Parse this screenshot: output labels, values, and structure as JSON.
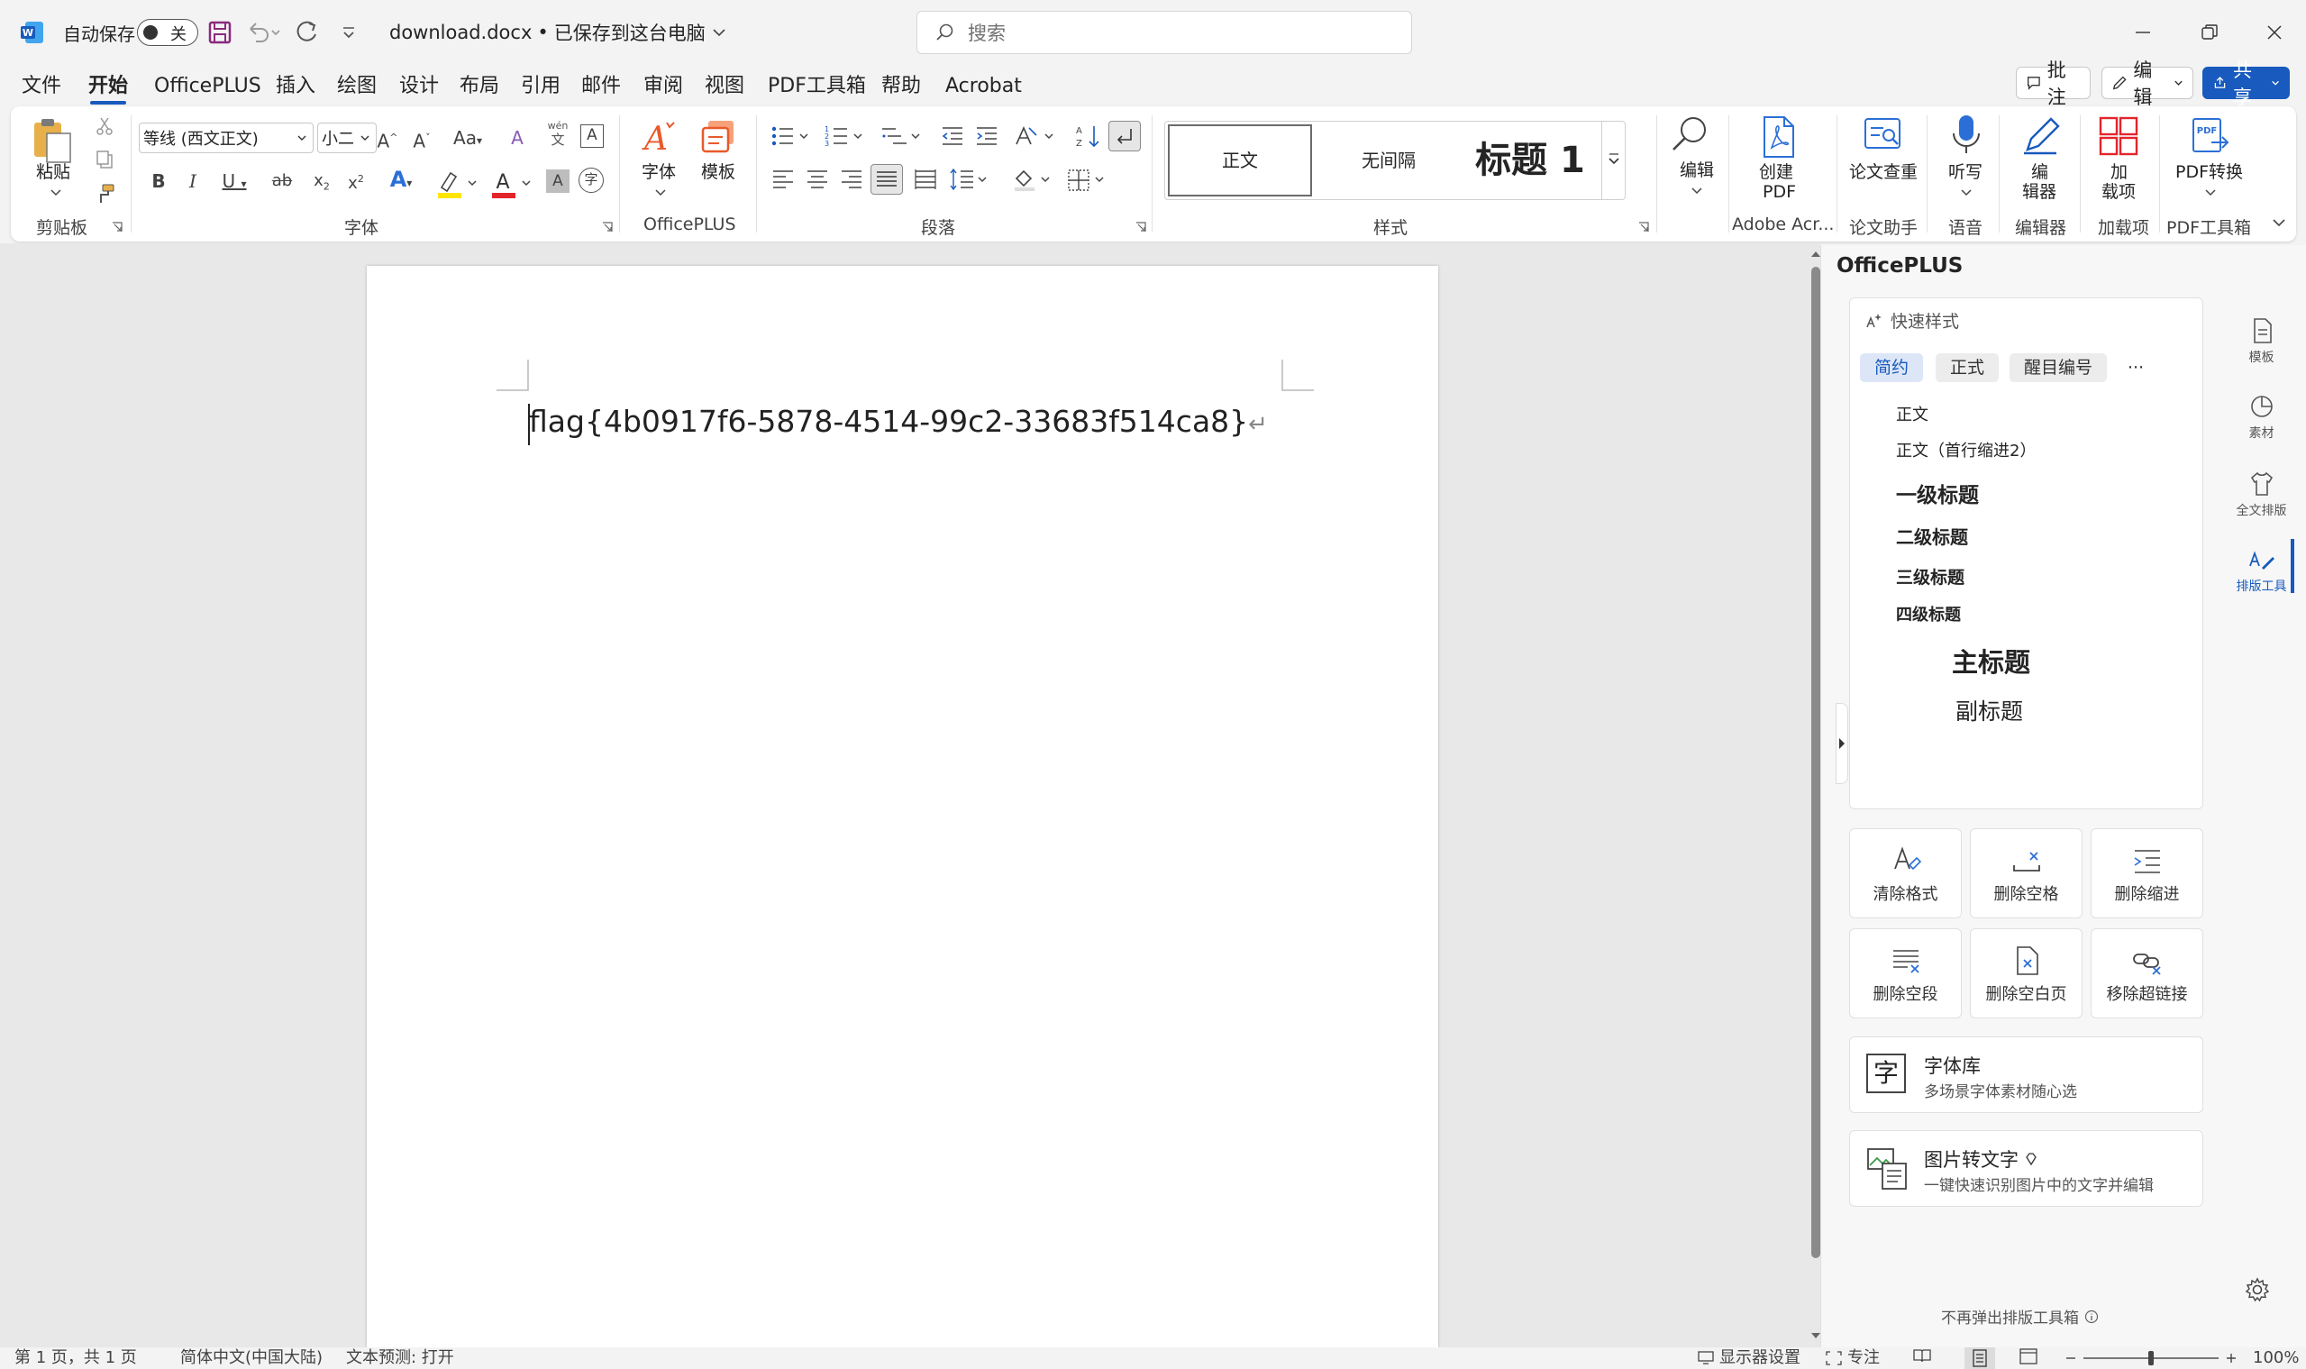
{
  "titlebar": {
    "autosave_label": "自动保存",
    "autosave_state": "关",
    "filename": "download.docx",
    "separator": "•",
    "save_status": "已保存到这台电脑",
    "search_placeholder": "搜索"
  },
  "menu": {
    "tabs": [
      "文件",
      "开始",
      "OfficePLUS",
      "插入",
      "绘图",
      "设计",
      "布局",
      "引用",
      "邮件",
      "审阅",
      "视图",
      "PDF工具箱",
      "帮助",
      "Acrobat"
    ],
    "active": "开始",
    "comment_button": "批注",
    "edit_button": "编辑",
    "share_button": "共享"
  },
  "ribbon": {
    "clipboard": {
      "paste": "粘贴",
      "group": "剪贴板"
    },
    "font": {
      "name": "等线 (西文正文)",
      "size": "小二",
      "group": "字体",
      "case": "Aa",
      "phonetic_top": "wén",
      "phonetic_bottom": "文"
    },
    "officeplus": {
      "font": "字体",
      "template": "模板",
      "group": "OfficePLUS"
    },
    "paragraph": {
      "group": "段落"
    },
    "styles": {
      "items": [
        "正文",
        "无间隔",
        "标题 1"
      ],
      "group": "样式"
    },
    "editing": {
      "label": "编辑"
    },
    "adobe": {
      "label_line1": "创建",
      "label_line2": "PDF",
      "group": "Adobe Acr..."
    },
    "paper": {
      "label": "论文查重",
      "group": "论文助手"
    },
    "voice": {
      "label": "听写",
      "group": "语音"
    },
    "editor": {
      "label_line1": "编",
      "label_line2": "辑器",
      "group": "编辑器"
    },
    "addins": {
      "label_line1": "加",
      "label_line2": "载项",
      "group": "加载项"
    },
    "pdftools": {
      "label": "PDF转换",
      "group": "PDF工具箱"
    }
  },
  "document": {
    "text": "flag{4b0917f6-5878-4514-99c2-33683f514ca8}",
    "para_mark": "↵"
  },
  "panel": {
    "title": "OfficePLUS",
    "quick_style_title": "快速样式",
    "style_tabs": [
      "简约",
      "正式",
      "醒目编号",
      "···"
    ],
    "active_style_tab": "简约",
    "styles": [
      "正文",
      "正文（首行缩进2）",
      "一级标题",
      "二级标题",
      "三级标题",
      "四级标题",
      "主标题",
      "副标题"
    ],
    "tools": [
      "清除格式",
      "删除空格",
      "删除缩进",
      "删除空段",
      "删除空白页",
      "移除超链接"
    ],
    "font_lib": {
      "title": "字体库",
      "desc": "多场景字体素材随心选"
    },
    "ocr": {
      "title": "图片转文字",
      "desc": "一键快速识别图片中的文字并编辑"
    },
    "footer": "不再弹出排版工具箱"
  },
  "rail": [
    "模板",
    "素材",
    "全文排版",
    "排版工具"
  ],
  "status": {
    "page": "第 1 页，共 1 页",
    "language": "简体中文(中国大陆)",
    "prediction": "文本预测: 打开",
    "display": "显示器设置",
    "focus": "专注",
    "zoom": "100%"
  }
}
